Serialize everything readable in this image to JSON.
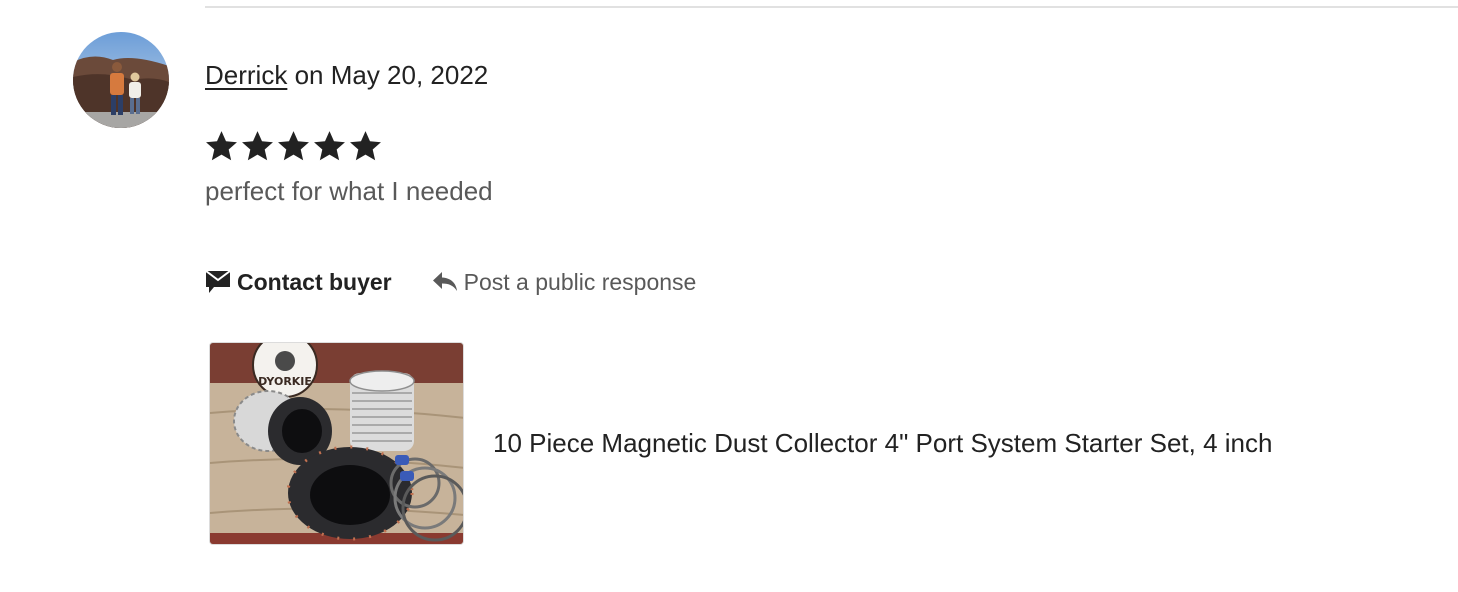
{
  "review": {
    "reviewer_name": "Derrick",
    "date_text": " on May 20, 2022",
    "rating": 5,
    "rating_max": 5,
    "text": "perfect for what I needed"
  },
  "actions": {
    "contact_buyer_label": "Contact buyer",
    "public_response_label": "Post a public response"
  },
  "product": {
    "title": "10 Piece Magnetic Dust Collector 4\" Port System Starter Set, 4 inch",
    "image_logo_text": "DYORKIE"
  },
  "icons": {
    "contact": "envelope-flag-icon",
    "reply": "reply-arrow-icon",
    "star": "star-icon"
  },
  "colors": {
    "text_primary": "#222222",
    "text_secondary": "#595959",
    "divider": "#e1e1e1"
  }
}
